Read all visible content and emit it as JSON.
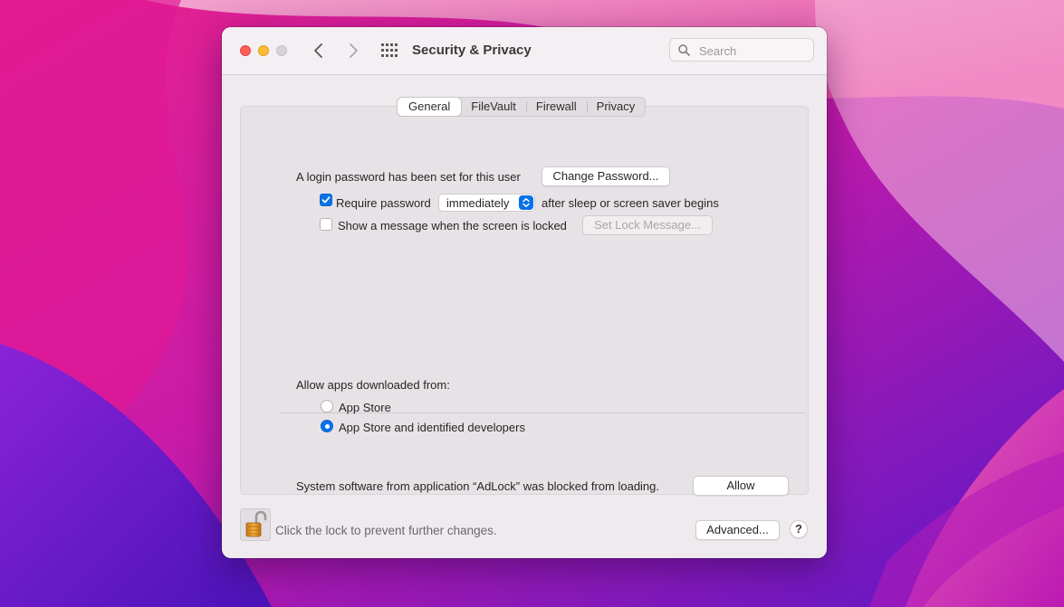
{
  "window": {
    "title": "Security & Privacy"
  },
  "search": {
    "placeholder": "Search"
  },
  "tabs": [
    {
      "label": "General",
      "selected": true
    },
    {
      "label": "FileVault",
      "selected": false
    },
    {
      "label": "Firewall",
      "selected": false
    },
    {
      "label": "Privacy",
      "selected": false
    }
  ],
  "general": {
    "login_password_text": "A login password has been set for this user",
    "change_password_label": "Change Password...",
    "require_password": {
      "label": "Require password",
      "checked": true,
      "delay_value": "immediately",
      "suffix": "after sleep or screen saver begins"
    },
    "show_message": {
      "label": "Show a message when the screen is locked",
      "checked": false,
      "button_label": "Set Lock Message..."
    },
    "allow_apps": {
      "heading": "Allow apps downloaded from:",
      "options": [
        {
          "label": "App Store",
          "selected": false
        },
        {
          "label": "App Store and identified developers",
          "selected": true
        }
      ]
    },
    "blocked": {
      "text": "System software from application “AdLock” was blocked from loading.",
      "allow_label": "Allow"
    }
  },
  "footer": {
    "lock_text": "Click the lock to prevent further changes.",
    "advanced_label": "Advanced...",
    "help_label": "?"
  },
  "colors": {
    "accent": "#0a72e8",
    "close": "#fe5f57",
    "minimize": "#febc2e",
    "zoom": "#d8d3d7"
  },
  "icons": {
    "back": "chevron-left-icon",
    "forward": "chevron-right-icon",
    "grid": "grid-icon",
    "search": "magnifying-glass-icon",
    "lock": "unlocked-padlock-icon"
  }
}
